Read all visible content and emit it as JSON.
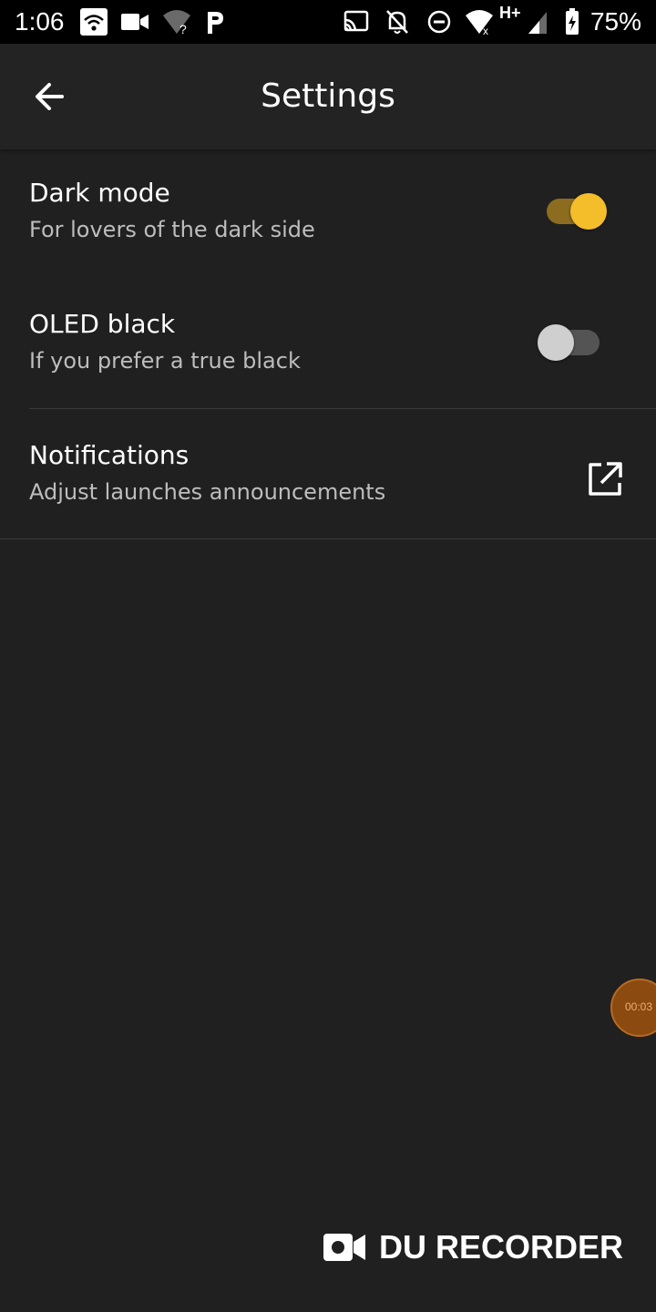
{
  "status_bar": {
    "time": "1:06",
    "battery_percent": "75%",
    "network_label": "H+"
  },
  "app_bar": {
    "title": "Settings",
    "back_icon": "arrow-back-icon"
  },
  "settings": [
    {
      "title": "Dark mode",
      "subtitle": "For lovers of the dark side",
      "control": "switch",
      "checked": true
    },
    {
      "title": "OLED black",
      "subtitle": "If you prefer a true black",
      "control": "switch",
      "checked": false
    },
    {
      "title": "Notifications",
      "subtitle": "Adjust launches announcements",
      "control": "open-in-new-icon"
    }
  ],
  "recorder": {
    "timer": "00:03",
    "watermark": "DU RECORDER"
  },
  "colors": {
    "background": "#202020",
    "app_bar": "#232323",
    "accent": "#f4bd2a",
    "accent_track": "#8c6d1f",
    "subtitle": "#bdbdbd"
  }
}
